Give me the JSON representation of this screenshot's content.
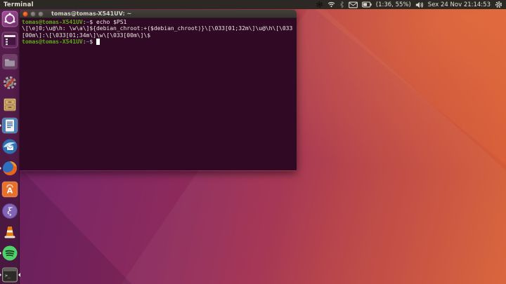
{
  "colors": {
    "panel_bg": "#2c2925",
    "launcher_bg": "#47193f",
    "terminal_bg": "#300a24",
    "terminal_fg": "#eeeae5",
    "prompt_green": "#5fa819",
    "path_blue": "#729fcf",
    "close_button_orange": "#e95420",
    "titlebar_bg": "#3b3834",
    "wallpaper_purple": "#7b2767",
    "wallpaper_orange": "#d95f35"
  },
  "top_bar": {
    "app_name": "Terminal",
    "battery_text": "(1:36, 55%)",
    "clock": "Sex 24 Nov 21:14:53",
    "tray_icons": [
      "tray-app-icon",
      "wifi-icon",
      "bluetooth-icon",
      "mail-icon",
      "battery-icon",
      "volume-icon",
      "session-gear-icon"
    ]
  },
  "window": {
    "title": "tomas@tomas-X541UV: ~",
    "controls": [
      "close",
      "minimize",
      "maximize"
    ]
  },
  "terminal": {
    "lines": [
      {
        "segments": [
          {
            "text": "tomas@tomas-X541UV",
            "color": "green"
          },
          {
            "text": ":",
            "color": "fg"
          },
          {
            "text": "~",
            "color": "blue"
          },
          {
            "text": "$ ",
            "color": "fg"
          },
          {
            "text": "echo $PS1",
            "color": "fg"
          }
        ]
      },
      {
        "segments": [
          {
            "text": "\\[\\e]0;\\u@\\h: \\w\\a\\]${debian_chroot:+($debian_chroot)}\\[\\033[01;32m\\]\\u@\\h\\[\\033",
            "color": "fg"
          }
        ]
      },
      {
        "segments": [
          {
            "text": "[00m\\]:\\[\\033[01;34m\\]\\w\\[\\033[00m\\]\\$",
            "color": "fg"
          }
        ]
      },
      {
        "segments": [
          {
            "text": "tomas@tomas-X541UV",
            "color": "green"
          },
          {
            "text": ":",
            "color": "fg"
          },
          {
            "text": "~",
            "color": "blue"
          },
          {
            "text": "$ ",
            "color": "fg"
          },
          {
            "cursor": true
          }
        ]
      }
    ]
  },
  "launcher": {
    "items": [
      {
        "id": "dash",
        "icon": "ubuntu-dash-icon",
        "running": false,
        "focused": false
      },
      {
        "id": "desktop-window",
        "icon": "desktop-window-icon",
        "running": false,
        "focused": false
      },
      {
        "id": "files",
        "icon": "file-manager-icon",
        "running": false,
        "focused": false
      },
      {
        "id": "settings",
        "icon": "system-settings-icon",
        "running": false,
        "focused": false
      },
      {
        "id": "home-folder",
        "icon": "home-folder-icon",
        "running": false,
        "focused": false
      },
      {
        "id": "libreoffice-writer",
        "icon": "libreoffice-writer-icon",
        "running": true,
        "focused": false
      },
      {
        "id": "thunderbird",
        "icon": "thunderbird-icon",
        "running": false,
        "focused": false
      },
      {
        "id": "firefox",
        "icon": "firefox-icon",
        "running": true,
        "focused": false
      },
      {
        "id": "ubuntu-software",
        "icon": "ubuntu-software-icon",
        "running": false,
        "focused": false
      },
      {
        "id": "emacs",
        "icon": "emacs-icon",
        "running": false,
        "focused": false
      },
      {
        "id": "vlc",
        "icon": "vlc-icon",
        "running": false,
        "focused": false
      },
      {
        "id": "spotify",
        "icon": "spotify-icon",
        "running": true,
        "focused": false
      },
      {
        "id": "terminal",
        "icon": "terminal-icon",
        "running": true,
        "focused": true
      }
    ]
  }
}
